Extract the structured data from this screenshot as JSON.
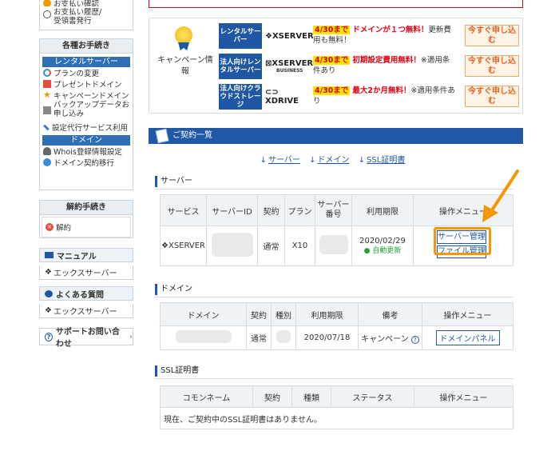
{
  "sidebar": {
    "top_items": [
      "お支払い確認",
      "お支払い履歴/\n受領書発行"
    ],
    "procedures": {
      "heading": "各種お手続き",
      "rental_sub": "レンタルサーバー",
      "rental_items": [
        "プランの変更",
        "プレゼントドメイン",
        "キャンペーンドメイン",
        "バックアップデータお申し込み",
        "設定代行サービス利用"
      ],
      "domain_sub": "ドメイン",
      "domain_items": [
        "Whois登録情報設定",
        "ドメイン契約移行"
      ]
    },
    "cancel": {
      "heading": "解約手続き",
      "item": "解約"
    },
    "manual": {
      "label": "マニュアル",
      "sub": "エックスサーバー"
    },
    "faq": {
      "label": "よくある質問",
      "sub": "エックスサーバー"
    },
    "support": {
      "label": "サポートお問い合わせ"
    }
  },
  "campaign": {
    "label": "キャンペーン情報",
    "rows": [
      {
        "tag": "レンタルサーバー",
        "logo": "XSERVER",
        "logo_sub": "",
        "date": "4/30まで",
        "highlight": "ドメインが１つ無料！",
        "rest": "更新費用も無料！",
        "button": "今すぐ申し込む"
      },
      {
        "tag": "法人向けレンタルサーバー",
        "logo": "XSERVER",
        "logo_sub": "BUSINESS",
        "date": "4/30まで",
        "highlight": "初期設定費用無料！",
        "rest": "※適用条件あり",
        "button": "今すぐ申し込む"
      },
      {
        "tag": "法人向けクラウドストレージ",
        "logo": "XDRIVE",
        "logo_sub": "",
        "date": "4/30まで",
        "highlight": "最大2か月無料！",
        "rest": "※適用条件あり",
        "button": "今すぐ申し込む"
      }
    ]
  },
  "contracts": {
    "title": "ご契約一覧",
    "anchors": [
      "サーバー",
      "ドメイン",
      "SSL証明書"
    ],
    "server": {
      "title": "サーバー",
      "headers": [
        "サービス",
        "サーバーID",
        "契約",
        "プラン",
        "サーバー番号",
        "利用期限",
        "操作メニュー"
      ],
      "row": {
        "service": "XSERVER",
        "contract": "通常",
        "plan": "X10",
        "expiry": "2020/02/29",
        "auto": "自動更新",
        "button": "サーバー管理",
        "button2": "ファイル管理"
      }
    },
    "domain": {
      "title": "ドメイン",
      "headers": [
        "ドメイン",
        "契約",
        "種別",
        "利用期限",
        "備考",
        "操作メニュー"
      ],
      "row": {
        "contract": "通常",
        "expiry": "2020/07/18",
        "note": "キャンペーン",
        "button": "ドメインパネル"
      }
    },
    "ssl": {
      "title": "SSL証明書",
      "headers": [
        "コモンネーム",
        "契約",
        "種類",
        "ステータス",
        "操作メニュー"
      ],
      "empty": "現在、ご契約中のSSL証明書はありません。"
    }
  },
  "colors": {
    "primary": "#1f58a6",
    "accent": "#f39800",
    "alert": "#e60012"
  }
}
